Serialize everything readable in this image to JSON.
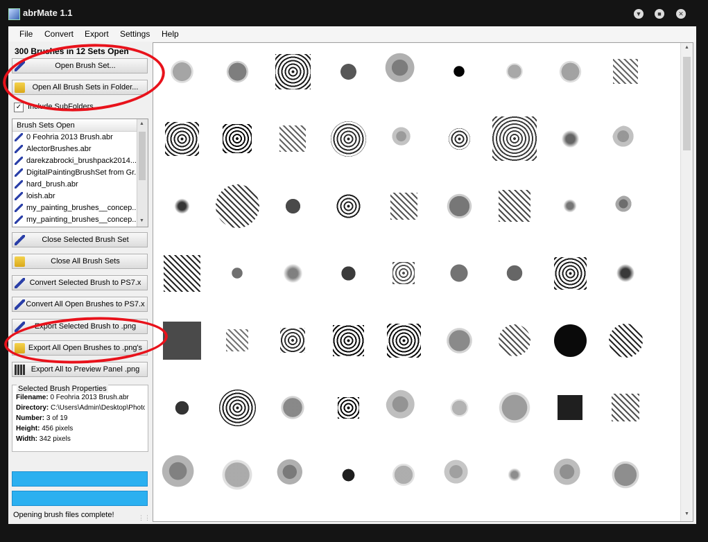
{
  "window": {
    "title": "abrMate 1.1"
  },
  "menu": [
    "File",
    "Convert",
    "Export",
    "Settings",
    "Help"
  ],
  "left_panel": {
    "summary": "300 Brushes in 12 Sets Open",
    "open_brush_set": "Open Brush Set...",
    "open_all_brush_sets": "Open All Brush Sets in Folder...",
    "include_subfolders": "Include SubFolders",
    "include_subfolders_checked": true,
    "brush_sets_header": "Brush Sets Open",
    "brush_sets": [
      "0 Feohria 2013 Brush.abr",
      "AlectorBrushes.abr",
      "darekzabrocki_brushpack2014...",
      "DigitalPaintingBrushSet from Gr...",
      "hard_brush.abr",
      "loish.abr",
      "my_painting_brushes__concep...",
      "my_painting_brushes__concep..."
    ],
    "close_selected": "Close Selected Brush Set",
    "close_all": "Close All Brush Sets",
    "convert_selected": "Convert Selected Brush to PS7.x",
    "convert_all": "Convert All Open Brushes to PS7.x",
    "export_selected": "Export Selected Brush to .png",
    "export_all": "Export All Open Brushes to .png's",
    "export_panel": "Export All to Preview Panel .png",
    "properties": {
      "caption": "Selected Brush Properties",
      "filename_label": "Filename:",
      "filename": "0 Feohria 2013 Brush.abr",
      "directory_label": "Directory:",
      "directory": "C:\\Users\\Admin\\Desktop\\Photos",
      "number_label": "Number:",
      "number": "3 of 19",
      "height_label": "Height:",
      "height": "456 pixels",
      "width_label": "Width:",
      "width": "342 pixels"
    },
    "progress_1": 1.0,
    "progress_2": 1.0
  },
  "status": "Opening brush files complete!",
  "colors": {
    "progress": "#2bb0f0",
    "annotation": "#e8121b"
  },
  "grid": {
    "rows": 7,
    "cols": 9
  }
}
